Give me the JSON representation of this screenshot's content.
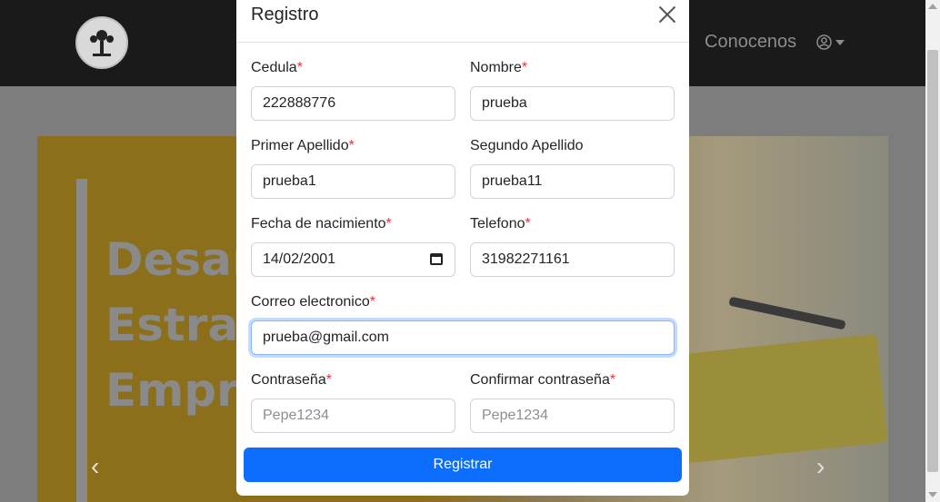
{
  "background": {
    "nav": {
      "link": "Conocenos"
    },
    "carousel": {
      "hero_lines": [
        "Desar",
        "Estrat",
        "Empre"
      ],
      "prev": "‹",
      "next": "›"
    }
  },
  "modal": {
    "title": "Registro",
    "close_icon": "close-icon",
    "fields": {
      "cedula": {
        "label": "Cedula",
        "value": "222888776",
        "required": "*"
      },
      "nombre": {
        "label": "Nombre",
        "value": "prueba",
        "required": "*"
      },
      "primer_apellido": {
        "label": "Primer Apellido",
        "value": "prueba1",
        "required": "*"
      },
      "segundo_apellido": {
        "label": "Segundo Apellido",
        "value": "prueba11"
      },
      "fecha_nacimiento": {
        "label": "Fecha de nacimiento",
        "value": "14/02/2001",
        "required": "*"
      },
      "telefono": {
        "label": "Telefono",
        "value": "31982271161",
        "required": "*"
      },
      "correo": {
        "label": "Correo electronico",
        "value": "prueba@gmail.com",
        "required": "*"
      },
      "contrasena": {
        "label": "Contraseña",
        "placeholder": "Pepe1234",
        "required": "*"
      },
      "confirmar": {
        "label": "Confirmar contraseña",
        "placeholder": "Pepe1234",
        "required": "*"
      }
    },
    "submit_label": "Registrar"
  },
  "colors": {
    "primary": "#0d6efd",
    "required": "#dc3545",
    "navbar": "#1a1a1a"
  }
}
